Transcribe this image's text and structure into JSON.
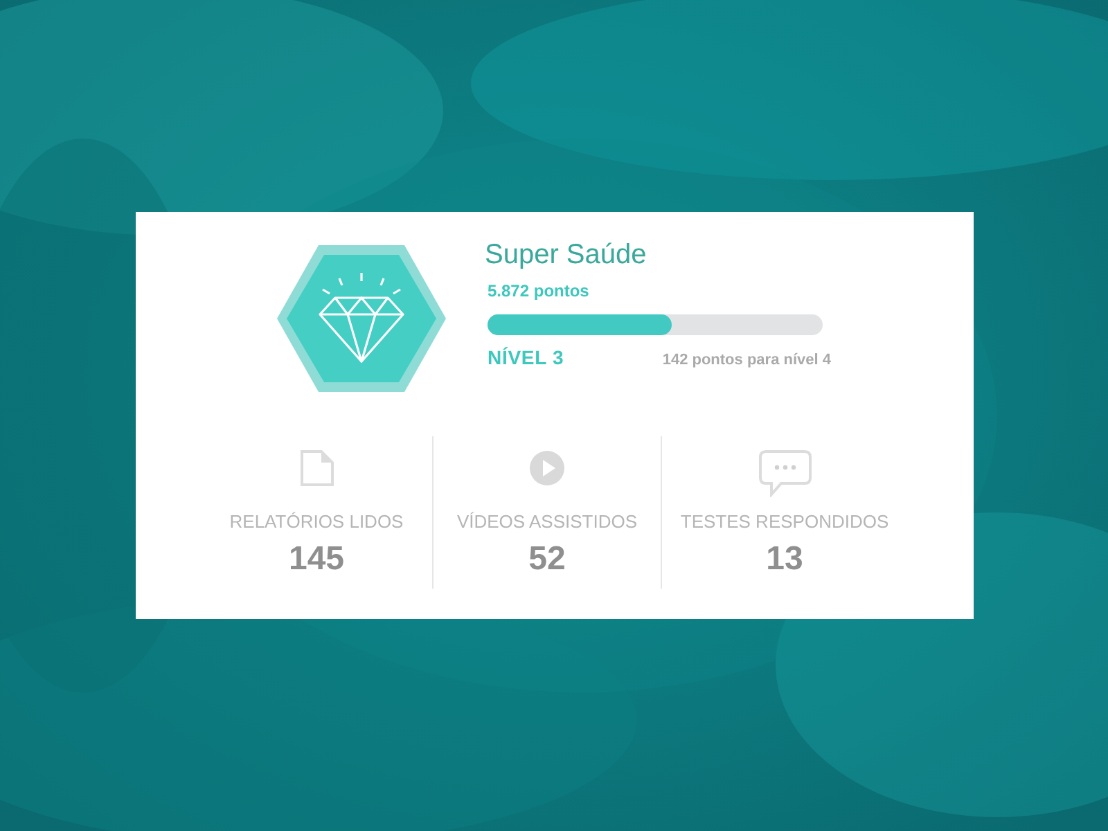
{
  "badge": {
    "title": "Super Saúde",
    "points": "5.872 pontos",
    "level": 0.55,
    "level_label": "NÍVEL 3",
    "next_level": "142 pontos para **nível 4**"
  },
  "stats": [
    {
      "kind": "document",
      "label": "RELATÓRIOS LIDOS",
      "value": "145"
    },
    {
      "kind": "play",
      "label": "VÍDEOS ASSISTIDOS",
      "value": "52"
    },
    {
      "kind": "chat",
      "label": "TESTES RESPONDIDOS",
      "value": "13"
    }
  ]
}
